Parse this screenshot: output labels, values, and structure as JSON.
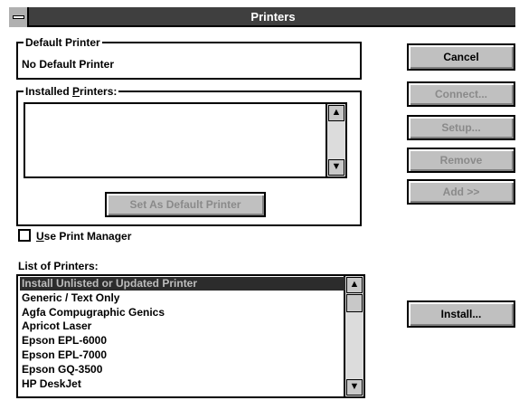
{
  "window": {
    "title": "Printers"
  },
  "default_printer": {
    "label": "Default Printer",
    "value": "No Default Printer"
  },
  "installed_printers": {
    "label_prefix": "Installed ",
    "label_mnemonic": "P",
    "label_suffix": "rinters:",
    "items": [],
    "set_default_button": "Set As Default Printer"
  },
  "use_print_manager": {
    "label_mnemonic": "U",
    "label_rest": "se Print Manager",
    "checked": false
  },
  "list_of_printers": {
    "label": "List of Printers:",
    "items": [
      "Install Unlisted or Updated Printer",
      "Generic / Text Only",
      "Agfa Compugraphic Genics",
      "Apricot Laser",
      "Epson EPL-6000",
      "Epson EPL-7000",
      "Epson GQ-3500",
      "HP DeskJet"
    ],
    "selected_index": 0
  },
  "buttons": {
    "cancel": "Cancel",
    "connect": "Connect...",
    "setup": "Setup...",
    "remove": "Remove",
    "add": "Add >>",
    "install": "Install..."
  },
  "icons": {
    "scroll_up": "▲",
    "scroll_down": "▼"
  }
}
